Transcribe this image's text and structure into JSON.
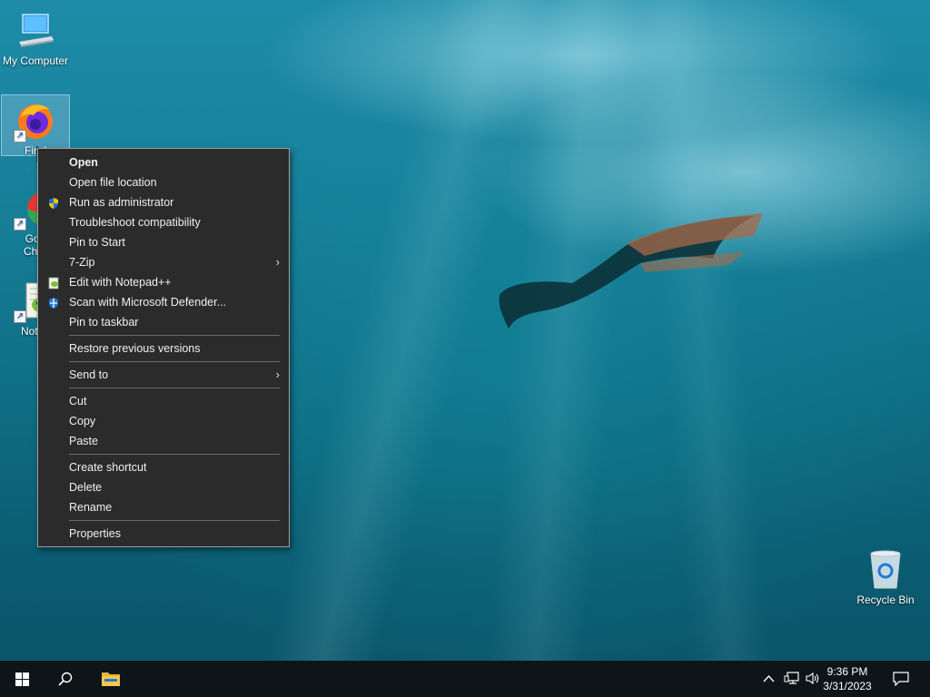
{
  "desktop": {
    "icons": [
      {
        "label": "My Computer"
      },
      {
        "label": "Firef"
      },
      {
        "label": "Goo\nChro"
      },
      {
        "label": "Notep"
      },
      {
        "label": "Recycle Bin"
      }
    ]
  },
  "context_menu": {
    "items": [
      {
        "label": "Open"
      },
      {
        "label": "Open file location"
      },
      {
        "label": "Run as administrator"
      },
      {
        "label": "Troubleshoot compatibility"
      },
      {
        "label": "Pin to Start"
      },
      {
        "label": "7-Zip"
      },
      {
        "label": "Edit with Notepad++"
      },
      {
        "label": "Scan with Microsoft Defender..."
      },
      {
        "label": "Pin to taskbar"
      },
      {
        "label": "Restore previous versions"
      },
      {
        "label": "Send to"
      },
      {
        "label": "Cut"
      },
      {
        "label": "Copy"
      },
      {
        "label": "Paste"
      },
      {
        "label": "Create shortcut"
      },
      {
        "label": "Delete"
      },
      {
        "label": "Rename"
      },
      {
        "label": "Properties"
      }
    ]
  },
  "taskbar": {
    "time": "9:36 PM",
    "date": "3/31/2023"
  },
  "colors": {
    "menu_bg": "#2b2b2b",
    "taskbar_bg": "#0e1518",
    "desktop_accent": "#167f98"
  }
}
